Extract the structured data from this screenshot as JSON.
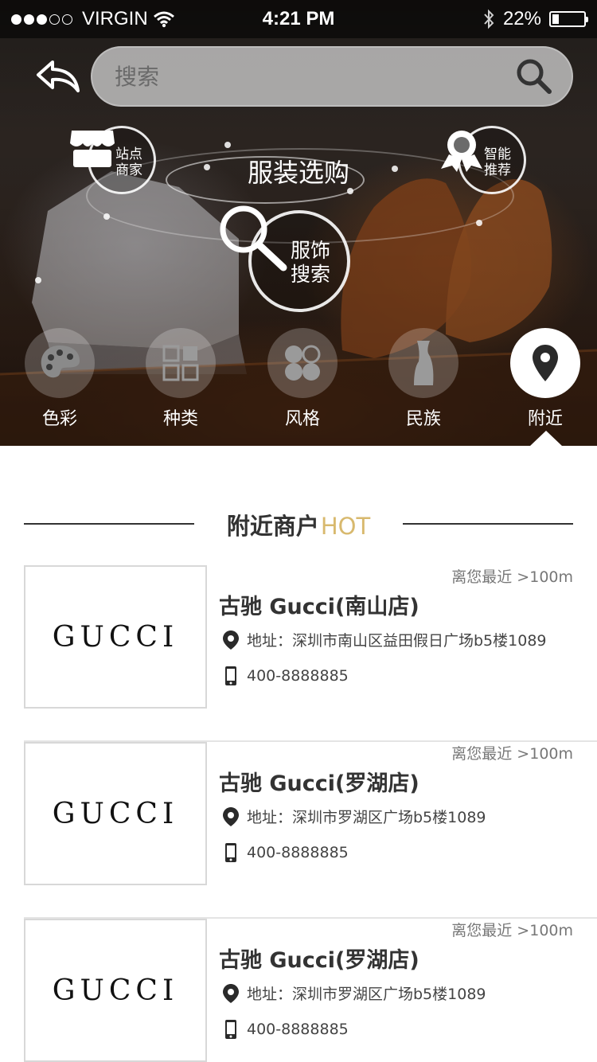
{
  "status_bar": {
    "carrier": "VIRGIN",
    "time": "4:21 PM",
    "battery": "22%",
    "battery_level": 0.22
  },
  "search": {
    "placeholder": "搜索"
  },
  "hero": {
    "title": "服装选购",
    "center_label_line1": "服饰",
    "center_label_line2": "搜索",
    "left_badge_line1": "站点",
    "left_badge_line2": "商家",
    "right_badge_line1": "智能",
    "right_badge_line2": "推荐"
  },
  "categories": [
    {
      "label": "色彩",
      "icon": "palette-icon",
      "active": false
    },
    {
      "label": "种类",
      "icon": "grid-icon",
      "active": false
    },
    {
      "label": "风格",
      "icon": "clover-icon",
      "active": false
    },
    {
      "label": "民族",
      "icon": "garment-icon",
      "active": false
    },
    {
      "label": "附近",
      "icon": "map-pin-icon",
      "active": true
    }
  ],
  "section": {
    "title": "附近商户",
    "hot": "HOT",
    "hot_color": "#d8b96e"
  },
  "shops": [
    {
      "logo": "GUCCI",
      "distance": "离您最近 >100m",
      "name": "古驰 Gucci(南山店)",
      "address": "地址：深圳市南山区益田假日广场b5楼1089",
      "phone": "400-8888885"
    },
    {
      "logo": "GUCCI",
      "distance": "离您最近 >100m",
      "name": "古驰 Gucci(罗湖店)",
      "address": "地址：深圳市罗湖区广场b5楼1089",
      "phone": "400-8888885"
    },
    {
      "logo": "GUCCI",
      "distance": "离您最近 >100m",
      "name": "古驰 Gucci(罗湖店)",
      "address": "地址：深圳市罗湖区广场b5楼1089",
      "phone": "400-8888885"
    }
  ]
}
